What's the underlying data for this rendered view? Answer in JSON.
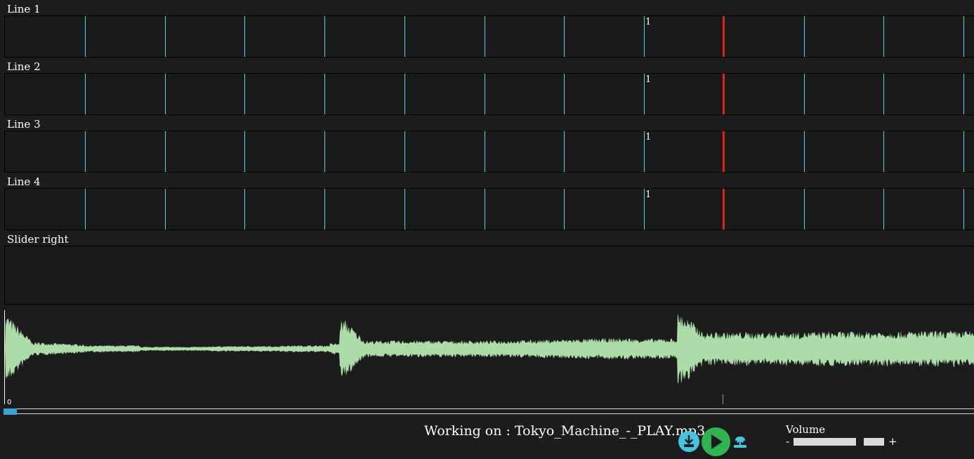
{
  "lanes": [
    {
      "label": "Line 1",
      "beat_number": "1"
    },
    {
      "label": "Line 2",
      "beat_number": "1"
    },
    {
      "label": "Line 3",
      "beat_number": "1"
    },
    {
      "label": "Line 4",
      "beat_number": "1"
    }
  ],
  "slider_lane": {
    "label": "Slider right"
  },
  "timeline": {
    "start_label": "0"
  },
  "status": {
    "working_on": "Working on : Tokyo_Machine_-_PLAY.mp3"
  },
  "volume": {
    "label": "Volume",
    "minus": "-",
    "plus": "+"
  },
  "icons": {
    "download": "download-icon",
    "play": "play-icon",
    "upload": "upload-icon"
  },
  "colors": {
    "background": "#1c1c1d",
    "beat_line": "#5fd3dc",
    "playhead": "#e0211c",
    "waveform": "#acdca8",
    "timeline_thumb": "#36a6d6",
    "play_button": "#2fb54f",
    "aux_button": "#45c6e0"
  }
}
